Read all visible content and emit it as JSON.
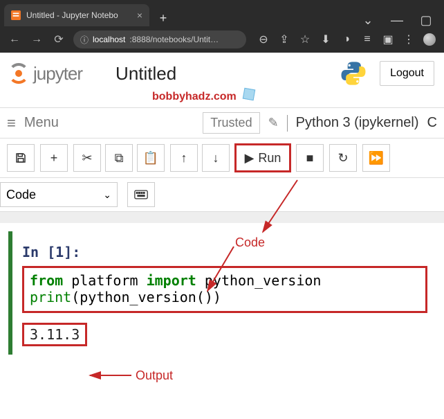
{
  "browser": {
    "tab_title": "Untitled - Jupyter Notebo",
    "url_host": "localhost",
    "url_rest": ":8888/notebooks/Untit…"
  },
  "header": {
    "brand": "jupyter",
    "title": "Untitled",
    "subtitle": "bobbyhadz.com",
    "logout": "Logout"
  },
  "menubar": {
    "menu": "Menu",
    "trusted": "Trusted",
    "kernel": "Python 3 (ipykernel)"
  },
  "toolbar": {
    "run": "Run",
    "celltype": "Code"
  },
  "cell": {
    "prompt": "In [1]:",
    "code_line1_kw1": "from",
    "code_line1_mid1": " platform ",
    "code_line1_kw2": "import",
    "code_line1_mid2": " python_version",
    "code_line2_fn": "print",
    "code_line2_rest": "(python_version())",
    "output": "3.11.3"
  },
  "annotations": {
    "code_label": "Code",
    "output_label": "Output"
  }
}
